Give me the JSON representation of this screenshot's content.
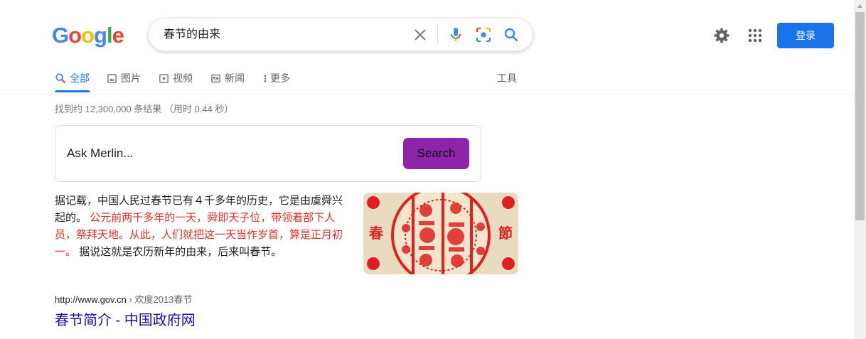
{
  "logo": {
    "letters": [
      "G",
      "o",
      "o",
      "g",
      "l",
      "e"
    ],
    "colors": [
      "#4285f4",
      "#ea4335",
      "#fbbc05",
      "#4285f4",
      "#34a853",
      "#ea4335"
    ]
  },
  "search": {
    "query": "春节的由来",
    "icons": [
      "clear-icon",
      "microphone-icon",
      "lens-icon",
      "search-icon"
    ]
  },
  "header": {
    "login_label": "登录",
    "icons": [
      "gear-icon",
      "apps-grid-icon"
    ]
  },
  "tabs": [
    {
      "label": "全部",
      "icon": "search-icon",
      "active": true
    },
    {
      "label": "图片",
      "icon": "image-icon",
      "active": false
    },
    {
      "label": "视频",
      "icon": "play-icon",
      "active": false
    },
    {
      "label": "新闻",
      "icon": "news-icon",
      "active": false
    },
    {
      "label": "更多",
      "icon": "more-vertical-icon",
      "active": false
    }
  ],
  "tools_label": "工具",
  "stats": "找到约 12,300,000 条结果 （用时 0.44 秒）",
  "merlin": {
    "label": "Ask Merlin...",
    "button": "Search"
  },
  "snippet": {
    "part1": "据记载，中国人民过春节已有４千多年的历史，它是由虞舜兴起的。",
    "highlight": "公元前两千多年的一天，舜即天子位，带领着部下人员，祭拜天地。从此，人们就把这一天当作岁首，算是正月初一。",
    "part2": "据说这就是农历新年的由来，后来叫春节。",
    "image": {
      "left_char": "春",
      "right_char": "節"
    }
  },
  "result": {
    "url": "http://www.gov.cn",
    "breadcrumb": "› 欢度2013春节",
    "title": "春节简介 - 中国政府网"
  },
  "colors": {
    "accent": "#1a73e8",
    "merlin_button": "#8e24aa",
    "highlight": "#d93025",
    "link": "#1a0dab",
    "paper_red": "#e02020"
  }
}
